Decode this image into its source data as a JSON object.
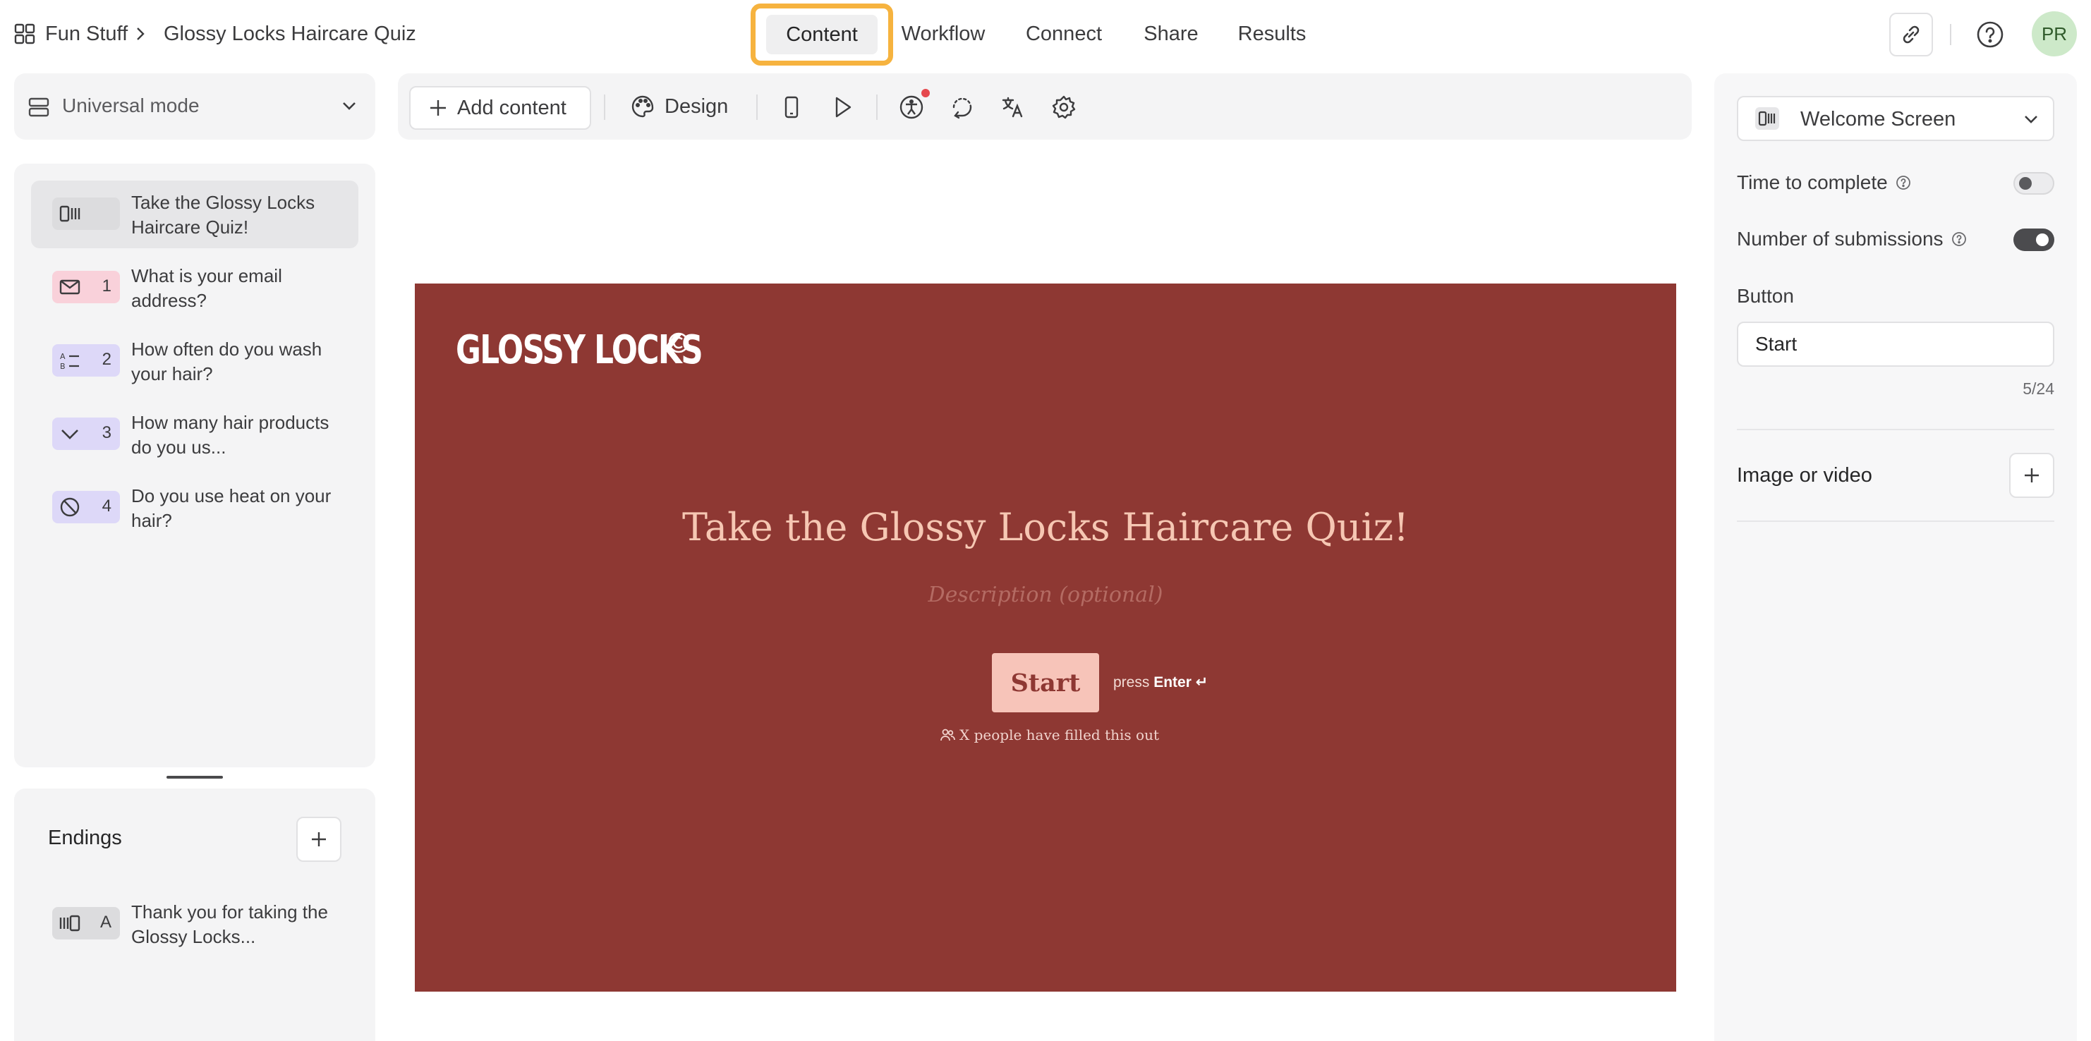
{
  "header": {
    "workspace": "Fun Stuff",
    "form_title": "Glossy Locks Haircare Quiz",
    "tabs": [
      {
        "label": "Content",
        "active": true
      },
      {
        "label": "Workflow",
        "active": false
      },
      {
        "label": "Connect",
        "active": false
      },
      {
        "label": "Share",
        "active": false
      },
      {
        "label": "Results",
        "active": false
      }
    ],
    "avatar_initials": "PR",
    "icons": {
      "grid": "grid-icon",
      "link": "link-icon",
      "help": "help-icon"
    }
  },
  "left": {
    "mode_label": "Universal mode",
    "questions": [
      {
        "icon": "welcome-screen-icon",
        "number": "",
        "text": "Take the Glossy Locks Haircare Quiz!",
        "badge_color": "#e6e6e8",
        "active": true
      },
      {
        "icon": "mail-icon",
        "number": "1",
        "text": "What is your email address?",
        "badge_color": "#f9d1da",
        "active": false
      },
      {
        "icon": "multiple-choice-icon",
        "number": "2",
        "text": "How often do you wash your hair?",
        "badge_color": "#ddd8f8",
        "active": false
      },
      {
        "icon": "dropdown-icon",
        "number": "3",
        "text": "How many hair products do you us...",
        "badge_color": "#ddd8f8",
        "active": false
      },
      {
        "icon": "yes-no-icon",
        "number": "4",
        "text": "Do you use heat on your hair?",
        "badge_color": "#ddd8f8",
        "active": false
      }
    ],
    "endings_title": "Endings",
    "endings": [
      {
        "icon": "end-screen-icon",
        "letter": "A",
        "text": "Thank you for taking the Glossy Locks..."
      }
    ]
  },
  "toolbar": {
    "add_content_label": "Add content",
    "design_label": "Design"
  },
  "canvas": {
    "background": "#8e3833",
    "logo_text": "GLOSSY LOCKS",
    "title": "Take the Glossy Locks Haircare Quiz!",
    "description_placeholder": "Description (optional)",
    "button_label": "Start",
    "press_prefix": "press",
    "press_key": "Enter ↵",
    "filled_out_text": "X people have filled this out"
  },
  "right": {
    "screen_type": "Welcome Screen",
    "time_to_complete_label": "Time to complete",
    "time_to_complete_on": false,
    "submissions_label": "Number of submissions",
    "submissions_on": true,
    "button_field_label": "Button",
    "button_value": "Start",
    "char_count": "5/24",
    "image_label": "Image or video"
  }
}
